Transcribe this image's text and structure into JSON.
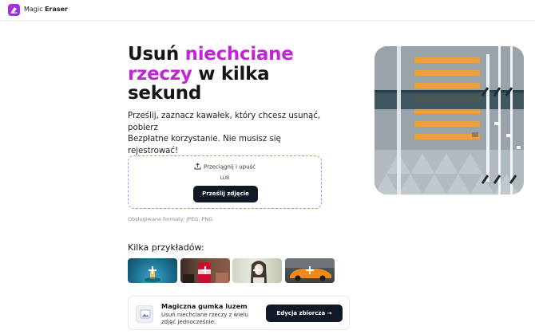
{
  "header": {
    "brand_name": "Magic",
    "brand_product": "Eraser"
  },
  "hero": {
    "title_part1": "Usuń ",
    "title_highlight": "niechciane rzeczy",
    "title_part2": " w kilka sekund",
    "subtitle_line1": "Prześlij, zaznacz kawałek, który chcesz usunąć, pobierz",
    "subtitle_line2": "Bezpłatne korzystanie. Nie musisz się rejestrować!"
  },
  "upload": {
    "drag_label": "Przeciągnij i upuść",
    "or_label": "LUB",
    "button_label": "Prześlij zdjęcie",
    "formats_label": "Obsługiwane formaty: JPEG, PNG"
  },
  "examples": {
    "title": "Kilka przykładów:"
  },
  "batch": {
    "title": "Magiczna gumka luzem",
    "description": "Usuń niechciane rzeczy z wielu zdjęć jednocześnie.",
    "button_label": "Edycja zbiorcza",
    "button_arrow": "→"
  },
  "colors": {
    "accent": "#c026d3",
    "button": "#111827"
  }
}
